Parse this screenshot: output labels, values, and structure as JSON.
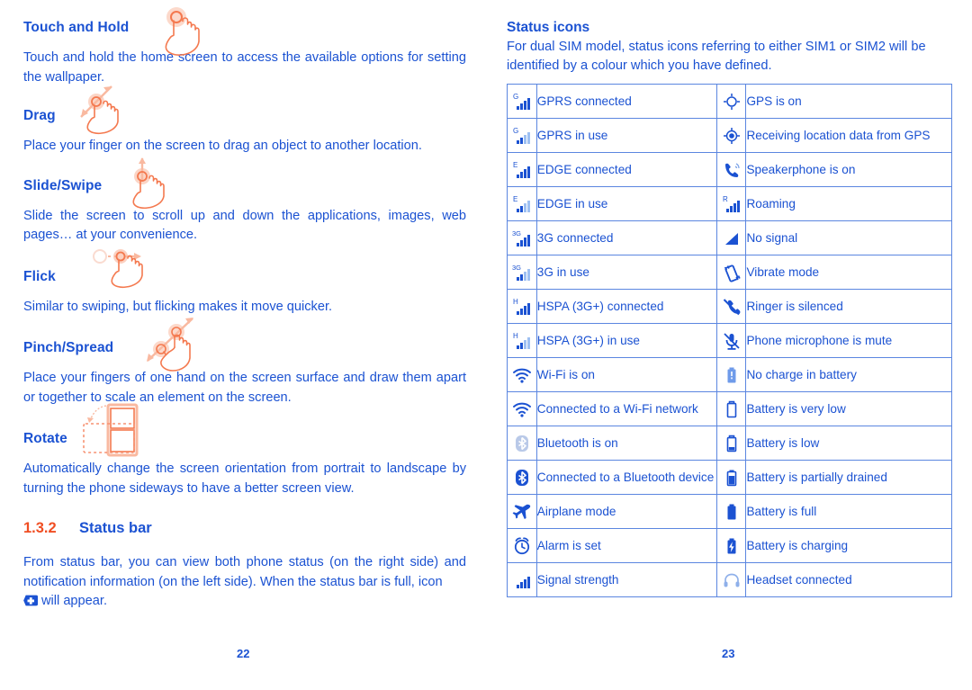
{
  "document": {
    "left_page_number": "22",
    "right_page_number": "23",
    "text_color": "#1b52d2",
    "accent_color": "#f04e23",
    "illustration_color": "#f79272"
  },
  "left": {
    "gestures": [
      {
        "title": "Touch and Hold",
        "body": "Touch and hold the home screen to access the available options for setting the wallpaper.",
        "icon": "hand-touch-hold-icon"
      },
      {
        "title": "Drag",
        "body": "Place your finger on the screen to drag an object to another location.",
        "icon": "hand-drag-icon"
      },
      {
        "title": "Slide/Swipe",
        "body": "Slide the screen to scroll up and down the applications, images, web pages… at your convenience.",
        "icon": "hand-slide-swipe-icon"
      },
      {
        "title": "Flick",
        "body": "Similar to swiping, but flicking makes it move quicker.",
        "icon": "hand-flick-icon"
      },
      {
        "title": "Pinch/Spread",
        "body": "Place your fingers of one hand on the screen surface and draw them apart or together to scale an element on the screen.",
        "icon": "hand-pinch-spread-icon"
      },
      {
        "title": "Rotate",
        "body": "Automatically change the screen orientation from portrait to landscape by turning the phone sideways to have a better screen view.",
        "icon": "phone-rotate-icon"
      }
    ],
    "section": {
      "number": "1.3.2",
      "title": "Status bar",
      "body_before_icon": "From status bar, you can view both phone status (on the right side) and notification information (on the left side). When the status bar is full,  icon",
      "inline_icon": "plus-badge-icon",
      "body_after_icon": "will appear."
    }
  },
  "right": {
    "title": "Status icons",
    "intro": "For dual SIM model, status icons referring to either SIM1 or SIM2 will be identified by a colour which you have defined.",
    "rows": [
      {
        "left_icon": "gprs-connected-icon",
        "left_label": "GPRS connected",
        "right_icon": "gps-on-icon",
        "right_label": "GPS is on"
      },
      {
        "left_icon": "gprs-in-use-icon",
        "left_label": "GPRS in use",
        "right_icon": "gps-receiving-icon",
        "right_label": "Receiving location data from GPS"
      },
      {
        "left_icon": "edge-connected-icon",
        "left_label": "EDGE connected",
        "right_icon": "speakerphone-on-icon",
        "right_label": "Speakerphone is on"
      },
      {
        "left_icon": "edge-in-use-icon",
        "left_label": "EDGE in use",
        "right_icon": "roaming-icon",
        "right_label": "Roaming"
      },
      {
        "left_icon": "3g-connected-icon",
        "left_label": "3G connected",
        "right_icon": "no-signal-icon",
        "right_label": "No signal"
      },
      {
        "left_icon": "3g-in-use-icon",
        "left_label": "3G in use",
        "right_icon": "vibrate-mode-icon",
        "right_label": "Vibrate mode"
      },
      {
        "left_icon": "hspa-connected-icon",
        "left_label": "HSPA (3G+) connected",
        "right_icon": "ringer-silenced-icon",
        "right_label": "Ringer is silenced"
      },
      {
        "left_icon": "hspa-in-use-icon",
        "left_label": "HSPA (3G+) in use",
        "right_icon": "microphone-mute-icon",
        "right_label": "Phone microphone is mute"
      },
      {
        "left_icon": "wifi-on-icon",
        "left_label": "Wi-Fi is on",
        "right_icon": "battery-empty-icon",
        "right_label": "No charge in battery"
      },
      {
        "left_icon": "wifi-connected-icon",
        "left_label": "Connected to a Wi-Fi network",
        "right_icon": "battery-very-low-icon",
        "right_label": "Battery is very low"
      },
      {
        "left_icon": "bluetooth-on-icon",
        "left_label": "Bluetooth is on",
        "right_icon": "battery-low-icon",
        "right_label": "Battery is low"
      },
      {
        "left_icon": "bluetooth-connected-icon",
        "left_label": "Connected to a Bluetooth device",
        "right_icon": "battery-partial-icon",
        "right_label": "Battery is partially drained"
      },
      {
        "left_icon": "airplane-mode-icon",
        "left_label": "Airplane mode",
        "right_icon": "battery-full-icon",
        "right_label": "Battery is full"
      },
      {
        "left_icon": "alarm-set-icon",
        "left_label": "Alarm is set",
        "right_icon": "battery-charging-icon",
        "right_label": "Battery is charging"
      },
      {
        "left_icon": "signal-strength-icon",
        "left_label": "Signal strength",
        "right_icon": "headset-connected-icon",
        "right_label": "Headset connected"
      }
    ]
  }
}
